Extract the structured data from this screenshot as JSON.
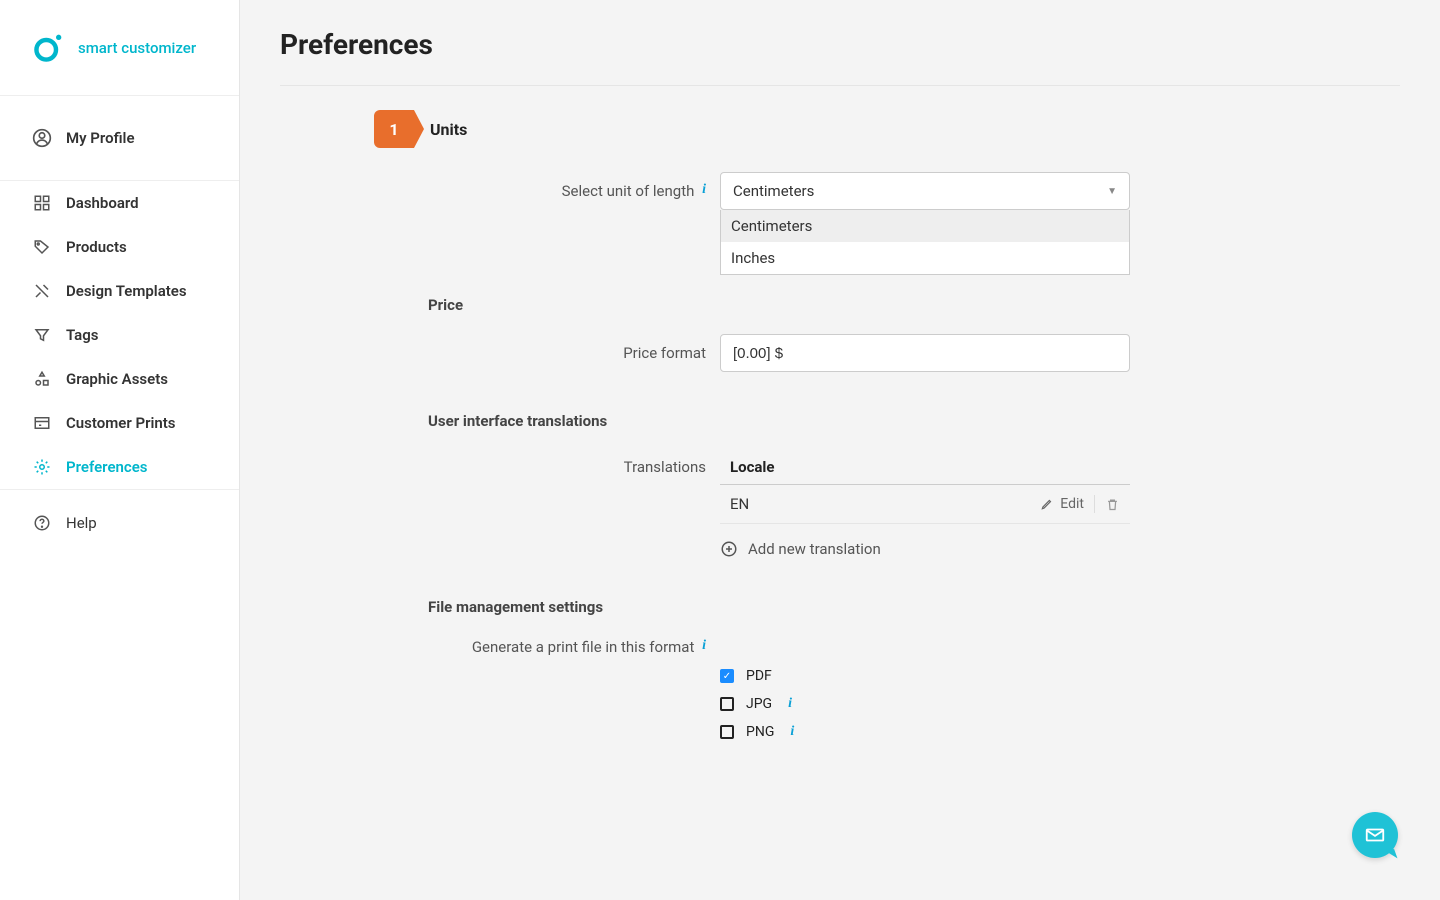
{
  "brand": {
    "name": "smart customizer"
  },
  "sidebar": {
    "profile_label": "My Profile",
    "items": [
      {
        "label": "Dashboard"
      },
      {
        "label": "Products"
      },
      {
        "label": "Design Templates"
      },
      {
        "label": "Tags"
      },
      {
        "label": "Graphic Assets"
      },
      {
        "label": "Customer Prints"
      },
      {
        "label": "Preferences"
      }
    ],
    "help_label": "Help"
  },
  "page": {
    "title": "Preferences"
  },
  "units": {
    "step_number": "1",
    "step_label": "Units",
    "length_label": "Select unit of length",
    "selected": "Centimeters",
    "options": [
      "Centimeters",
      "Inches"
    ]
  },
  "price": {
    "heading": "Price",
    "format_label": "Price format",
    "format_value": "[0.00] $"
  },
  "translations": {
    "heading": "User interface translations",
    "label": "Translations",
    "column_locale": "Locale",
    "rows": [
      {
        "locale": "EN"
      }
    ],
    "edit_label": "Edit",
    "add_label": "Add new translation"
  },
  "files": {
    "heading": "File management settings",
    "generate_label": "Generate a print file in this format",
    "formats": [
      {
        "name": "PDF",
        "checked": true,
        "info": false
      },
      {
        "name": "JPG",
        "checked": false,
        "info": true
      },
      {
        "name": "PNG",
        "checked": false,
        "info": true
      }
    ]
  }
}
